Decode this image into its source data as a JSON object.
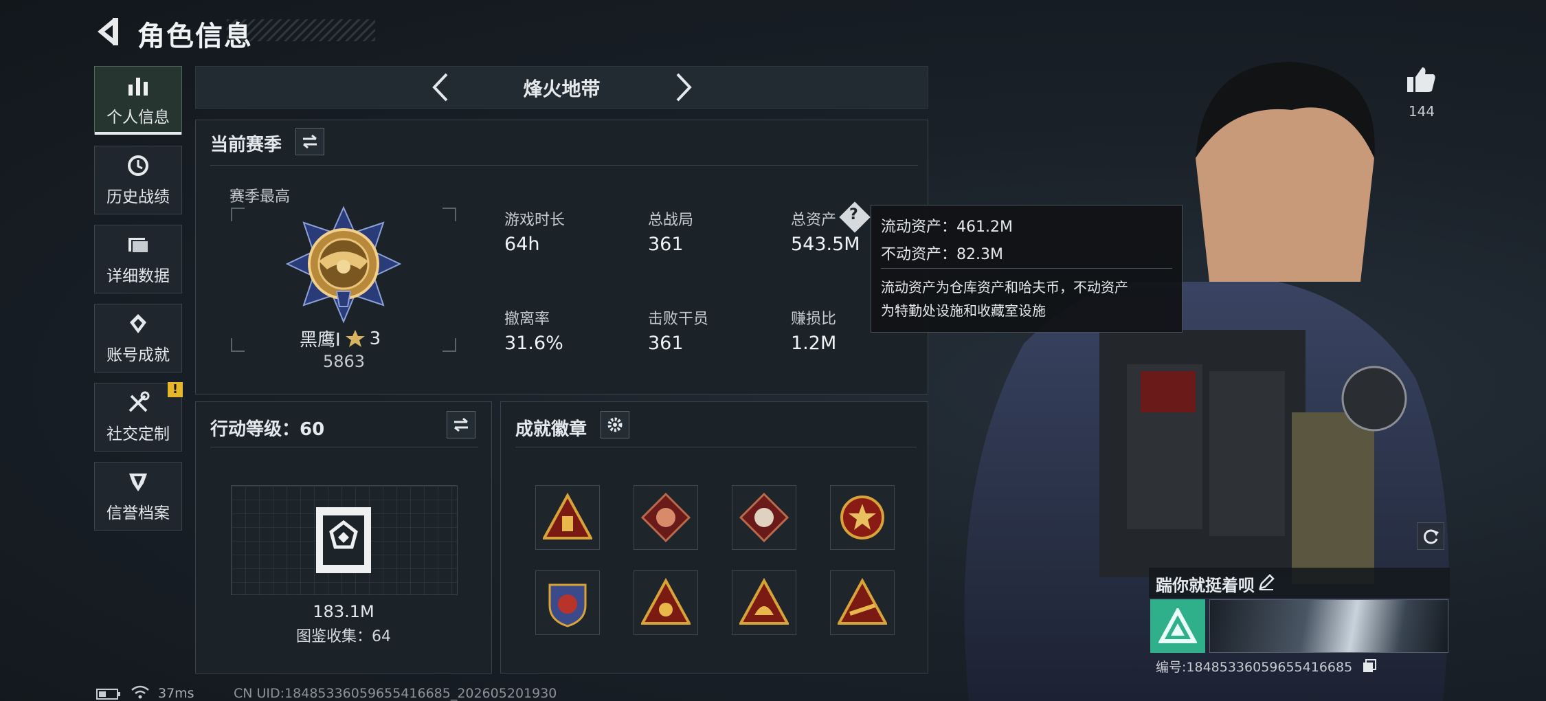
{
  "header": {
    "title": "角色信息"
  },
  "sidebar": {
    "items": [
      {
        "label": "个人信息",
        "icon": "bar-chart-icon"
      },
      {
        "label": "历史战绩",
        "icon": "history-icon"
      },
      {
        "label": "详细数据",
        "icon": "folder-icon"
      },
      {
        "label": "账号成就",
        "icon": "achievement-icon"
      },
      {
        "label": "社交定制",
        "icon": "tools-icon",
        "badge": "!"
      },
      {
        "label": "信誉档案",
        "icon": "shield-icon"
      }
    ]
  },
  "mode": {
    "title": "烽火地带"
  },
  "season": {
    "title": "当前赛季",
    "best_label": "赛季最高",
    "rank_name": "黑鹰Ⅰ",
    "rank_stars": "3",
    "rank_score": "5863",
    "stats": [
      {
        "label": "游戏时长",
        "value": "64h"
      },
      {
        "label": "总战局",
        "value": "361"
      },
      {
        "label": "总资产",
        "value": "543.5M"
      },
      {
        "label": "撤离率",
        "value": "31.6%"
      },
      {
        "label": "击败干员",
        "value": "361"
      },
      {
        "label": "赚损比",
        "value": "1.2M"
      }
    ]
  },
  "tooltip": {
    "liquid": "流动资产：461.2M",
    "fixed": "不动资产：82.3M",
    "desc1": "流动资产为仓库资产和哈夫币，不动资产",
    "desc2": "为特勤处设施和收藏室设施"
  },
  "action": {
    "title": "行动等级：60",
    "value": "183.1M",
    "collection": "图鉴收集：64"
  },
  "badges": {
    "title": "成就徽章"
  },
  "likes": {
    "count": "144"
  },
  "profile": {
    "name": "踹你就挺着呗",
    "id_line": "编号:18485336059655416685"
  },
  "footer": {
    "ping": "37ms",
    "uid": "CN UID:18485336059655416685_202605201930"
  },
  "colors": {
    "accent_green": "#2fb08a",
    "gold": "#c8a24a",
    "warn": "#e7b72b"
  }
}
